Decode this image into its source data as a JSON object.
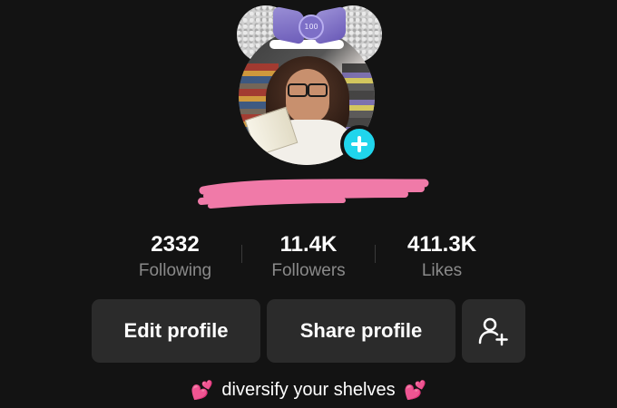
{
  "profile": {
    "avatar_badge": "100",
    "username": "",
    "add_icon": "plus-icon",
    "accent_color": "#20d5ec",
    "redaction_color": "#f07aa8"
  },
  "stats": {
    "following": {
      "value": "2332",
      "label": "Following"
    },
    "followers": {
      "value": "11.4K",
      "label": "Followers"
    },
    "likes": {
      "value": "411.3K",
      "label": "Likes"
    }
  },
  "actions": {
    "edit_label": "Edit profile",
    "share_label": "Share profile",
    "friend_icon": "add-friend-icon"
  },
  "bio": {
    "text": "diversify your shelves",
    "emoji_left": "💕",
    "emoji_right": "💕"
  }
}
